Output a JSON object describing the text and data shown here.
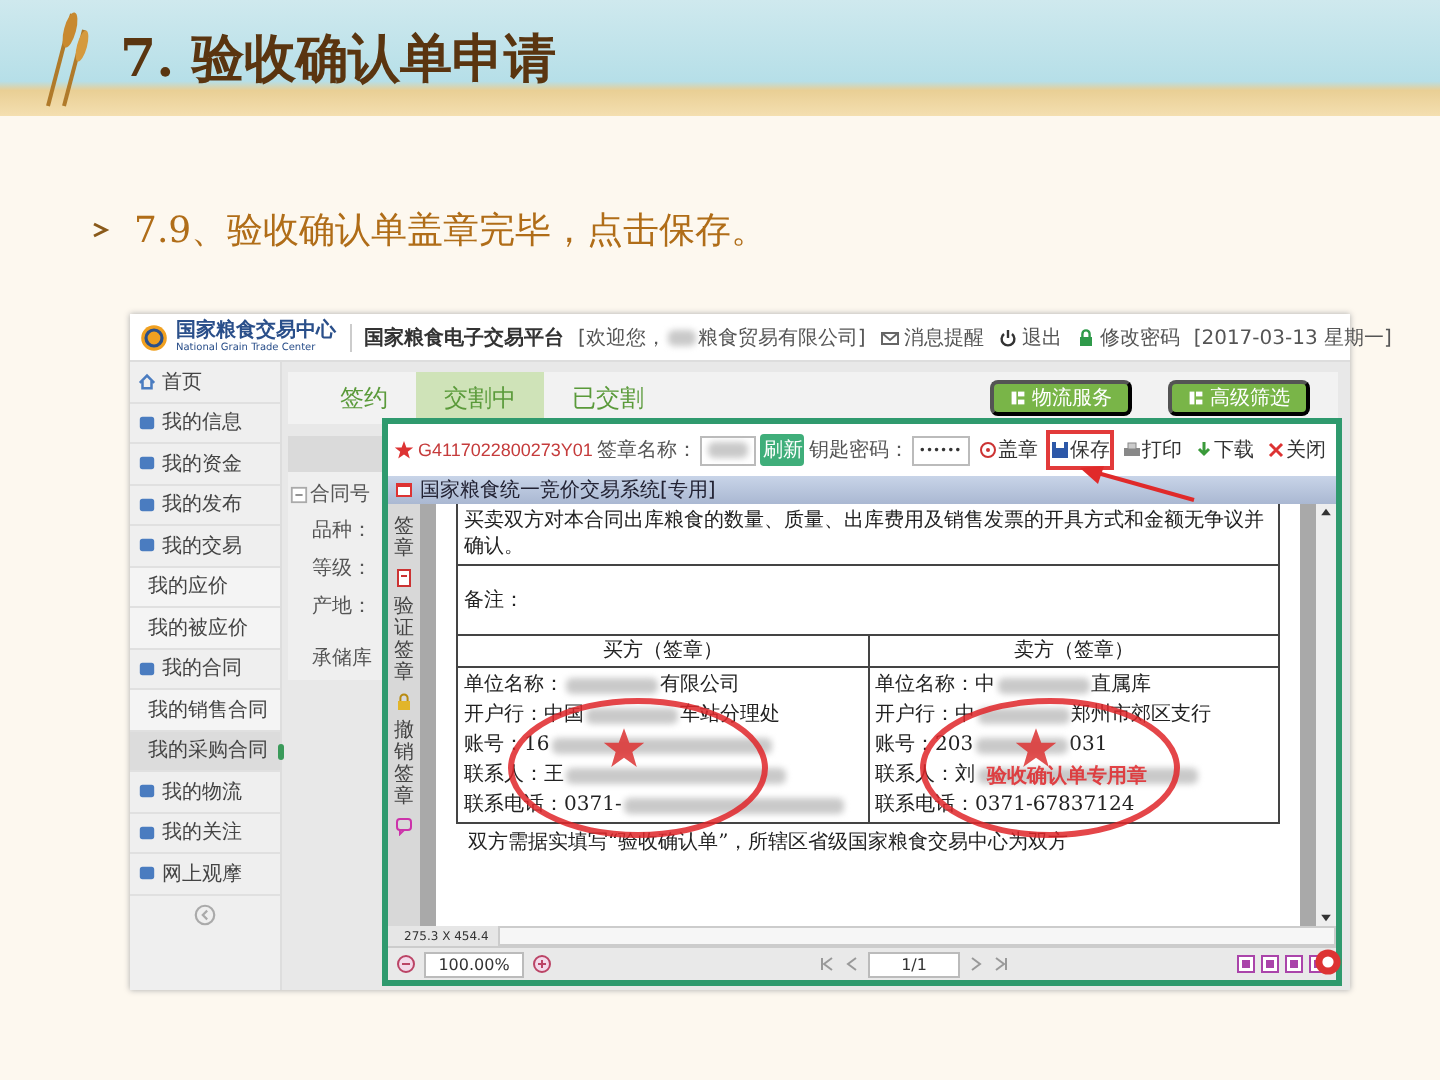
{
  "slide": {
    "title": "7. 验收确认单申请",
    "bullet": "7.9、验收确认单盖章完毕，点击保存。"
  },
  "portal": {
    "logo_name": "国家粮食交易中心",
    "logo_english": "National Grain Trade Center",
    "platform": "国家粮食电子交易平台",
    "welcome_start": "[欢迎您，",
    "welcome_end": "粮食贸易有限公司]",
    "links": [
      {
        "label": "消息提醒",
        "kind": "mail"
      },
      {
        "label": "退出",
        "kind": "power"
      },
      {
        "label": "修改密码",
        "kind": "lock"
      }
    ],
    "date": "[2017-03-13 星期一]"
  },
  "sidebar": {
    "items": [
      {
        "label": "首页",
        "kind": "main",
        "selected": false
      },
      {
        "label": "我的信息",
        "kind": "main",
        "selected": false
      },
      {
        "label": "我的资金",
        "kind": "main",
        "selected": false
      },
      {
        "label": "我的发布",
        "kind": "main",
        "selected": false
      },
      {
        "label": "我的交易",
        "kind": "main",
        "selected": false
      },
      {
        "label": "我的应价",
        "kind": "sub",
        "selected": false
      },
      {
        "label": "我的被应价",
        "kind": "sub",
        "selected": false
      },
      {
        "label": "我的合同",
        "kind": "main",
        "selected": false
      },
      {
        "label": "我的销售合同",
        "kind": "sub",
        "selected": false
      },
      {
        "label": "我的采购合同",
        "kind": "sub",
        "selected": true
      },
      {
        "label": "我的物流",
        "kind": "main",
        "selected": false
      },
      {
        "label": "我的关注",
        "kind": "main",
        "selected": false
      },
      {
        "label": "网上观摩",
        "kind": "main",
        "selected": false
      }
    ]
  },
  "tabs": [
    {
      "label": "签约",
      "selected": false
    },
    {
      "label": "交割中",
      "selected": true
    },
    {
      "label": "已交割",
      "selected": false
    }
  ],
  "buttons": [
    "物流服务",
    "高级筛选"
  ],
  "contract_list": {
    "header": "合同号",
    "fields": [
      "品种：",
      "等级：",
      "产地："
    ],
    "footer": "承储库"
  },
  "dialog": {
    "contract_no": "G4117022800273Y01",
    "seal_name_label": "签章名称：",
    "refresh": "刷新",
    "key_password_label": "钥匙密码：",
    "key_password": "••••••",
    "actions": [
      {
        "label": "盖章",
        "kind": "seal",
        "highlighted": false
      },
      {
        "label": "保存",
        "kind": "save",
        "highlighted": true
      },
      {
        "label": "打印",
        "kind": "print",
        "highlighted": false
      },
      {
        "label": "下载",
        "kind": "download",
        "highlighted": false
      },
      {
        "label": "关闭",
        "kind": "close",
        "highlighted": false
      }
    ],
    "viewer_title": "国家粮食统一竞价交易系统[专用]",
    "side_tools": [
      "签章",
      "验证签章",
      "撤销签章"
    ],
    "document": {
      "clause": "买卖双方对本合同出库粮食的数量、质量、出库费用及销售发票的开具方式和金额无争议并确认。",
      "remarks": "备注：",
      "parties": [
        {
          "heading": "买方（签章）",
          "lines": [
            [
              {
                "kind": "text",
                "text": "单位名称："
              },
              {
                "kind": "blur"
              },
              {
                "kind": "text",
                "text": "有限公司"
              }
            ],
            [
              {
                "kind": "text",
                "text": "开户行：中国"
              },
              {
                "kind": "blur"
              },
              {
                "kind": "text",
                "text": "车站分理处"
              }
            ],
            [
              {
                "kind": "text",
                "text": "账号：16"
              },
              {
                "kind": "blur"
              }
            ],
            [
              {
                "kind": "text",
                "text": "联系人：王"
              },
              {
                "kind": "blur"
              }
            ],
            [
              {
                "kind": "text",
                "text": "联系电话：0371-"
              },
              {
                "kind": "blur"
              }
            ]
          ]
        },
        {
          "heading": "卖方（签章）",
          "stamp": "验收确认单专用章",
          "lines": [
            [
              {
                "kind": "text",
                "text": "单位名称：中"
              },
              {
                "kind": "blur"
              },
              {
                "kind": "text",
                "text": "直属库"
              }
            ],
            [
              {
                "kind": "text",
                "text": "开户行：中"
              },
              {
                "kind": "blur"
              },
              {
                "kind": "text",
                "text": "郑州市郊区支行"
              }
            ],
            [
              {
                "kind": "text",
                "text": "账号：203"
              },
              {
                "kind": "blur"
              },
              {
                "kind": "text",
                "text": "031"
              }
            ],
            [
              {
                "kind": "text",
                "text": "联系人：刘"
              },
              {
                "kind": "blur"
              }
            ],
            [
              {
                "kind": "text",
                "text": "联系电话：0371-67837124"
              }
            ]
          ]
        }
      ],
      "footnote": "双方需据实填写“验收确认单”，所辖区省级国家粮食交易中心为双方"
    },
    "page_size": "275.3 X 454.4",
    "zoom": "100.00%",
    "page": "1/1"
  }
}
